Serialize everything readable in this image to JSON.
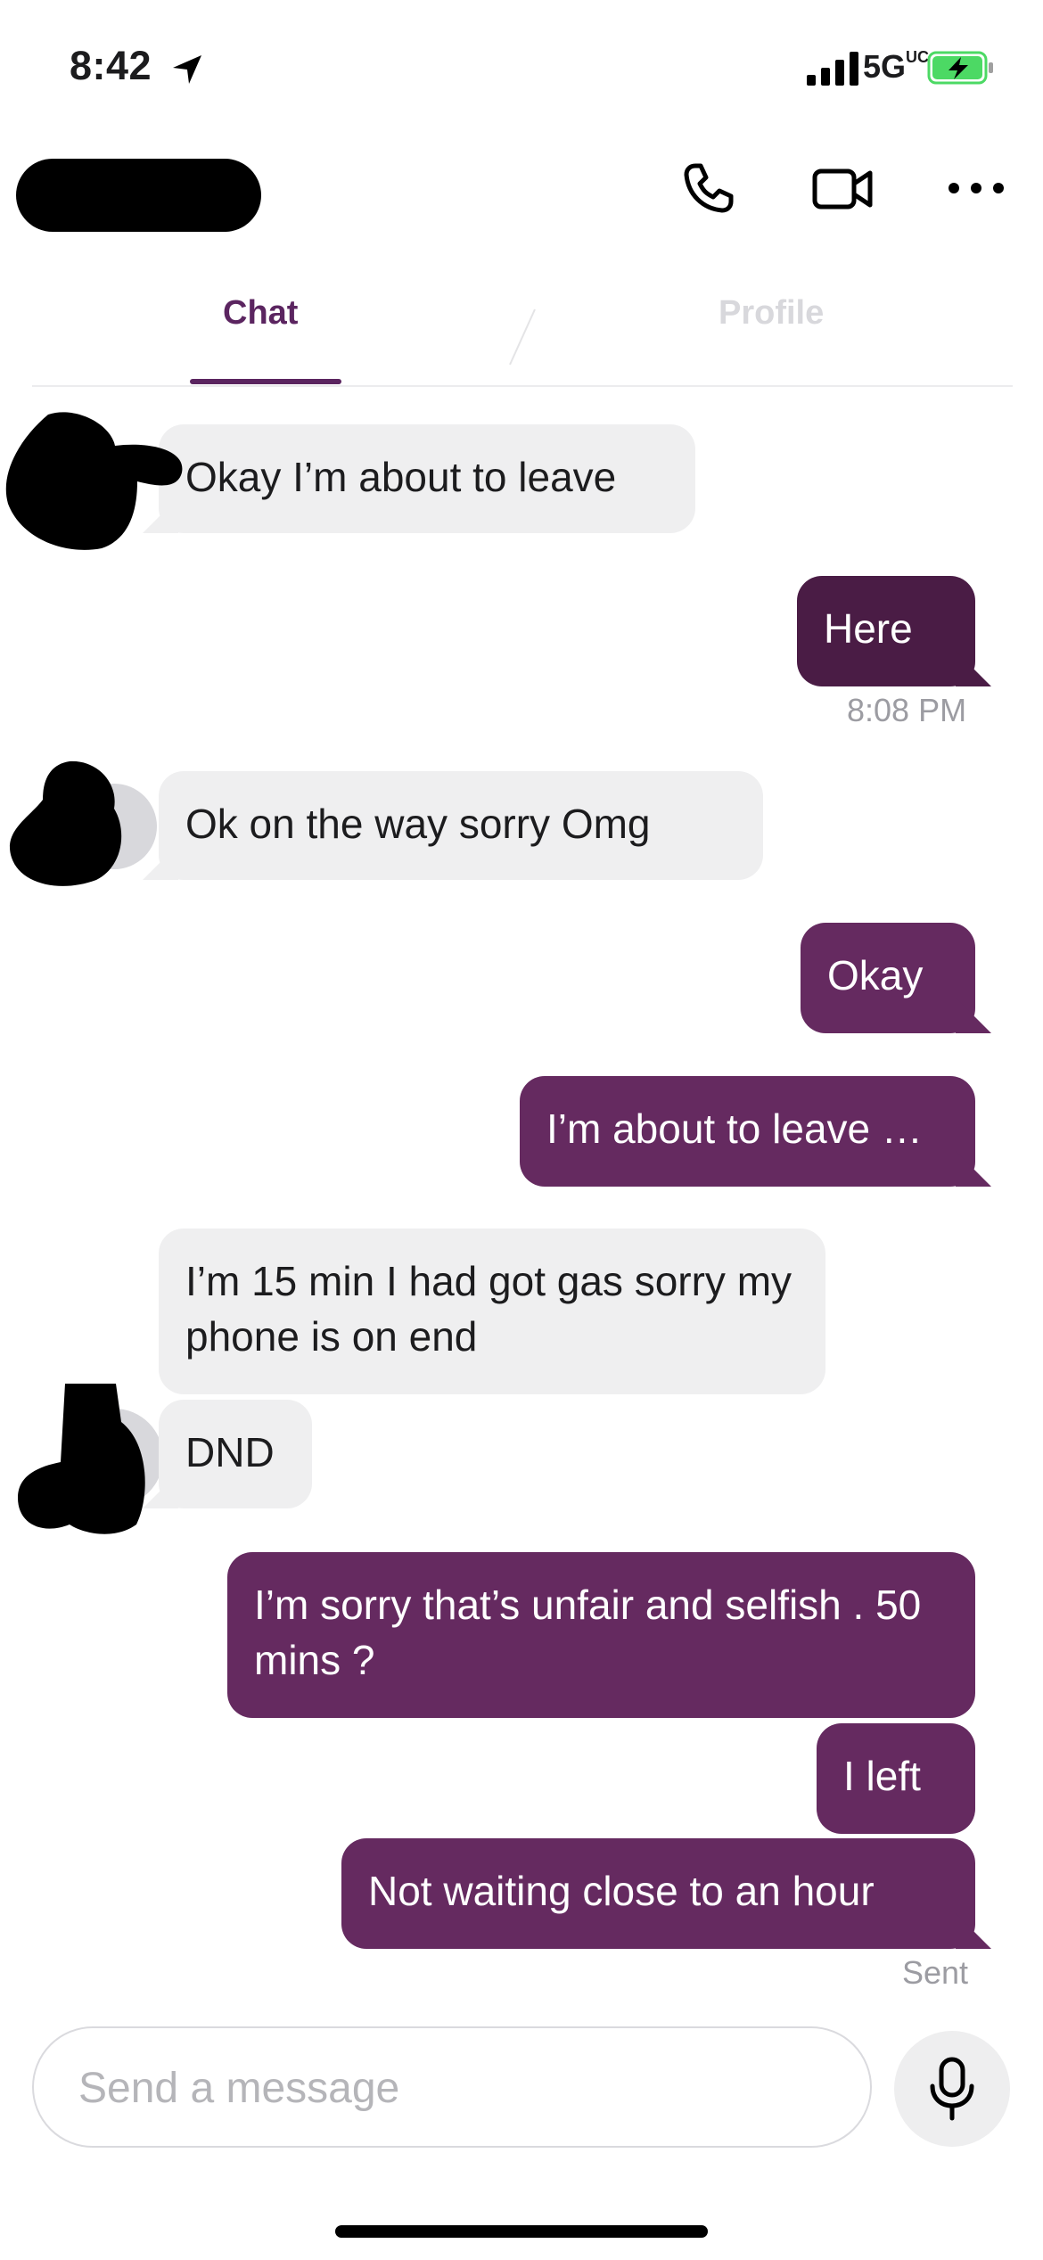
{
  "status_bar": {
    "time": "8:42",
    "network": "5G",
    "network_suffix": "UC",
    "battery_charging": true,
    "accent": "#4cd964"
  },
  "header": {
    "icons": [
      "phone-icon",
      "video-camera-icon",
      "more-icon"
    ]
  },
  "tabs": [
    {
      "label": "Chat",
      "active": true
    },
    {
      "label": "Profile",
      "active": false
    }
  ],
  "colors": {
    "brand": "#5b2560",
    "outgoing": "#652a60",
    "incoming": "#efeff0"
  },
  "messages": [
    {
      "dir": "in",
      "text": "Okay I’m about to leave"
    },
    {
      "dir": "out",
      "text": "Here",
      "time": "8:08 PM"
    },
    {
      "dir": "in",
      "text": "Ok on the way sorry Omg"
    },
    {
      "dir": "out",
      "text": "Okay"
    },
    {
      "dir": "out",
      "text": "I’m about to leave …"
    },
    {
      "dir": "in",
      "text": "I’m 15 min I had got gas sorry my phone is on end"
    },
    {
      "dir": "in",
      "text": "DND"
    },
    {
      "dir": "out",
      "text": "I’m sorry that’s unfair and selfish . 50 mins ?"
    },
    {
      "dir": "out",
      "text": "I left"
    },
    {
      "dir": "out",
      "text": "Not waiting close to an hour",
      "status": "Sent"
    }
  ],
  "composer": {
    "placeholder": "Send a message",
    "value": "",
    "mic_icon": "microphone-icon"
  }
}
